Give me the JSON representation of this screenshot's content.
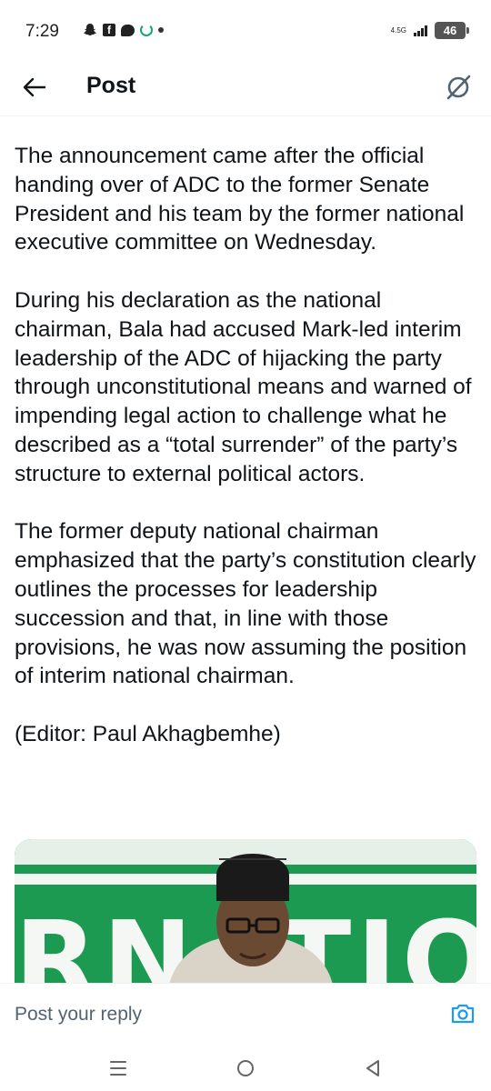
{
  "status_bar": {
    "time": "7:29",
    "network": "4.5G",
    "battery": "46"
  },
  "header": {
    "title": "Post",
    "back_icon": "arrow-left-icon",
    "grok_icon": "grok-icon"
  },
  "post": {
    "paragraphs": [
      "The announcement came after the official handing over of ADC to the former Senate President and his team by the former national executive committee on Wednesday.",
      "During his declaration as the national chairman, Bala had accused Mark-led interim leadership of the ADC of hijacking the party through unconstitutional means and warned of impending legal action to challenge what he described as a “total surrender” of the party’s structure to external political actors.",
      "The former deputy national chairman emphasized that the party’s constitution clearly outlines the processes for leadership succession and that, in line with those provisions, he was now assuming the position of interim national chairman.",
      "(Editor: Paul Akhagbemhe)"
    ],
    "media_banner_text": "RNATION"
  },
  "reply": {
    "placeholder": "Post your reply",
    "camera_icon": "camera-icon"
  },
  "colors": {
    "accent": "#1d9bf0",
    "text": "#0f1419",
    "muted": "#536471",
    "banner_green": "#1d9a52"
  }
}
